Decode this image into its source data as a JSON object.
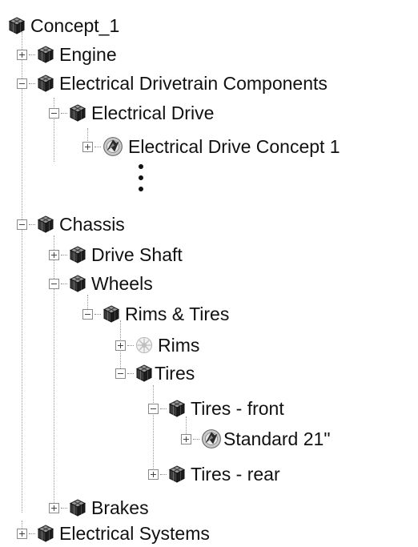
{
  "tree": {
    "root": {
      "label": "Concept_1",
      "icon": "assembly-icon"
    },
    "nodes": [
      {
        "key": "engine",
        "label": "Engine",
        "expanded": false,
        "icon": "assembly-icon"
      },
      {
        "key": "electrical_drivetrain",
        "label": "Electrical Drivetrain Components",
        "expanded": true,
        "icon": "assembly-icon"
      },
      {
        "key": "electrical_drive",
        "label": "Electrical Drive",
        "expanded": true,
        "icon": "assembly-icon"
      },
      {
        "key": "electrical_drive_concept",
        "label": "Electrical Drive Concept 1",
        "expanded": false,
        "icon": "component-icon"
      },
      {
        "key": "chassis",
        "label": "Chassis",
        "expanded": true,
        "icon": "assembly-icon"
      },
      {
        "key": "drive_shaft",
        "label": "Drive Shaft",
        "expanded": false,
        "icon": "assembly-icon"
      },
      {
        "key": "wheels",
        "label": "Wheels",
        "expanded": true,
        "icon": "assembly-icon"
      },
      {
        "key": "rims_tires",
        "label": "Rims & Tires",
        "expanded": true,
        "icon": "assembly-icon"
      },
      {
        "key": "rims",
        "label": "Rims",
        "expanded": false,
        "icon": "rim-icon"
      },
      {
        "key": "tires",
        "label": "Tires",
        "expanded": true,
        "icon": "assembly-icon"
      },
      {
        "key": "tires_front",
        "label": "Tires - front",
        "expanded": true,
        "icon": "assembly-icon"
      },
      {
        "key": "standard_21",
        "label": "Standard 21\"",
        "expanded": false,
        "icon": "component-icon"
      },
      {
        "key": "tires_rear",
        "label": "Tires - rear",
        "expanded": false,
        "icon": "assembly-icon"
      },
      {
        "key": "brakes",
        "label": "Brakes",
        "expanded": false,
        "icon": "assembly-icon"
      },
      {
        "key": "electrical_systems",
        "label": "Electrical Systems",
        "expanded": false,
        "icon": "assembly-icon"
      }
    ]
  }
}
